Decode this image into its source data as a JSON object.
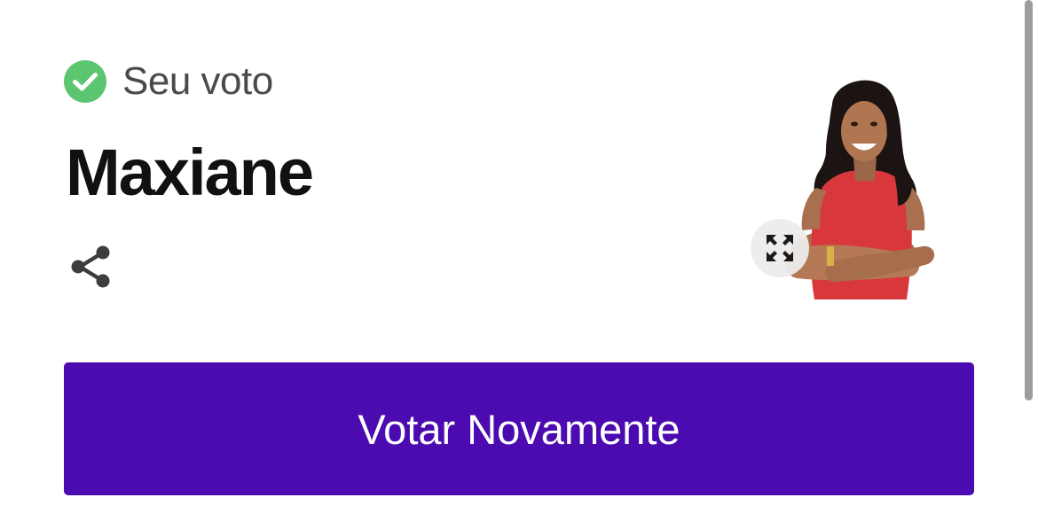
{
  "vote_status": {
    "icon": "check-circle-icon",
    "icon_color": "#5cc56f",
    "label": "Seu voto"
  },
  "candidate": {
    "name": "Maxiane",
    "photo": "candidate-photo"
  },
  "actions": {
    "share_icon": "share-icon",
    "expand_icon": "expand-icon",
    "vote_again_label": "Votar Novamente"
  },
  "colors": {
    "primary_button": "#4b0bb0",
    "text_dark": "#111111",
    "text_muted": "#4a4a4a"
  }
}
